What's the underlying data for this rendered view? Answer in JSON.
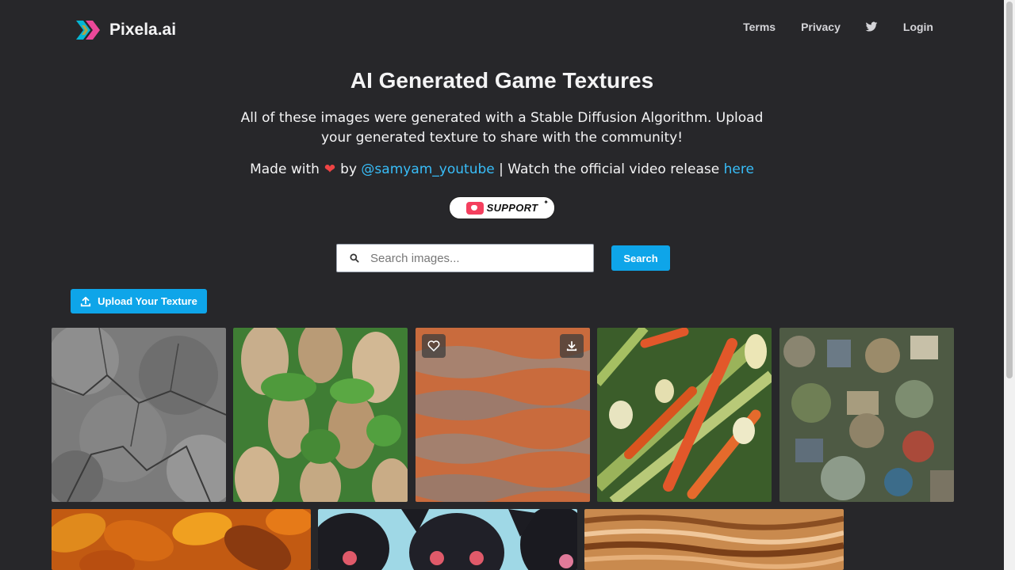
{
  "nav": {
    "brand": "Pixela.ai",
    "links": [
      "Terms",
      "Privacy",
      "Login"
    ],
    "twitter_icon": "twitter-icon"
  },
  "hero": {
    "title": "AI Generated Game Textures",
    "description": "All of these images were generated with a Stable Diffusion Algorithm. Upload your generated texture to share with the community!",
    "credit_prefix": "Made with",
    "credit_by": "by",
    "credit_handle": "@samyam_youtube",
    "credit_middle": "| Watch the official video release",
    "credit_link": "here",
    "support_label": "SUPPORT"
  },
  "search": {
    "placeholder": "Search images...",
    "value": "",
    "button_label": "Search"
  },
  "upload": {
    "label": "Upload Your Texture"
  },
  "gallery": {
    "tiles": [
      {
        "subject": "cracked gray stone"
      },
      {
        "subject": "rocky cliffs with moss"
      },
      {
        "subject": "orange sand dunes"
      },
      {
        "subject": "carrots and leeks"
      },
      {
        "subject": "pile of junk objects"
      },
      {
        "subject": "autumn leaves"
      },
      {
        "subject": "black furry creatures"
      },
      {
        "subject": "wood grain"
      }
    ],
    "hover_actions": [
      "heart-icon",
      "download-icon"
    ]
  },
  "colors": {
    "background": "#27272a",
    "accent": "#0ea5e9",
    "link": "#38bdf8",
    "heart": "#ef4444"
  }
}
